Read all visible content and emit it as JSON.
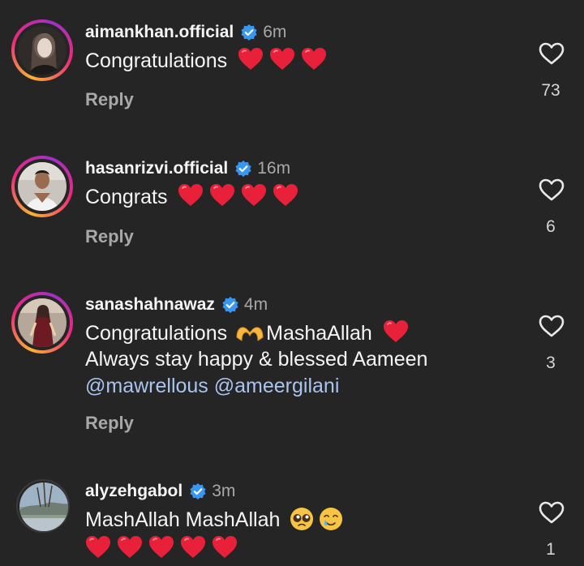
{
  "comments": [
    {
      "username": "aimankhan.official",
      "time": "6m",
      "text": "Congratulations",
      "reply_label": "Reply",
      "like_count": "73"
    },
    {
      "username": "hasanrizvi.official",
      "time": "16m",
      "text": "Congrats",
      "reply_label": "Reply",
      "like_count": "6"
    },
    {
      "username": "sanashahnawaz",
      "time": "4m",
      "text_line1_a": "Congratulations",
      "text_line1_b": "MashaAllah",
      "text_line2": "Always stay happy & blessed Aameen",
      "mention1": "@mawrellous",
      "mention2": "@ameergilani",
      "reply_label": "Reply",
      "like_count": "3"
    },
    {
      "username": "alyzehgabol",
      "time": "3m",
      "text": "MashAllah MashAllah",
      "like_count": "1"
    }
  ],
  "icons": {
    "verified": "verified-badge-icon",
    "like": "heart-outline-icon",
    "heart_emoji": "red-heart-emoji",
    "heart_hands": "heart-hands-emoji",
    "pleading": "pleading-face-emoji",
    "tear_smile": "smiling-face-with-tear-emoji"
  },
  "colors": {
    "background": "#252525",
    "verified": "#3897f0",
    "heart": "#e8203a",
    "mention": "#a9c4ee",
    "muted": "#a8a8a8"
  }
}
